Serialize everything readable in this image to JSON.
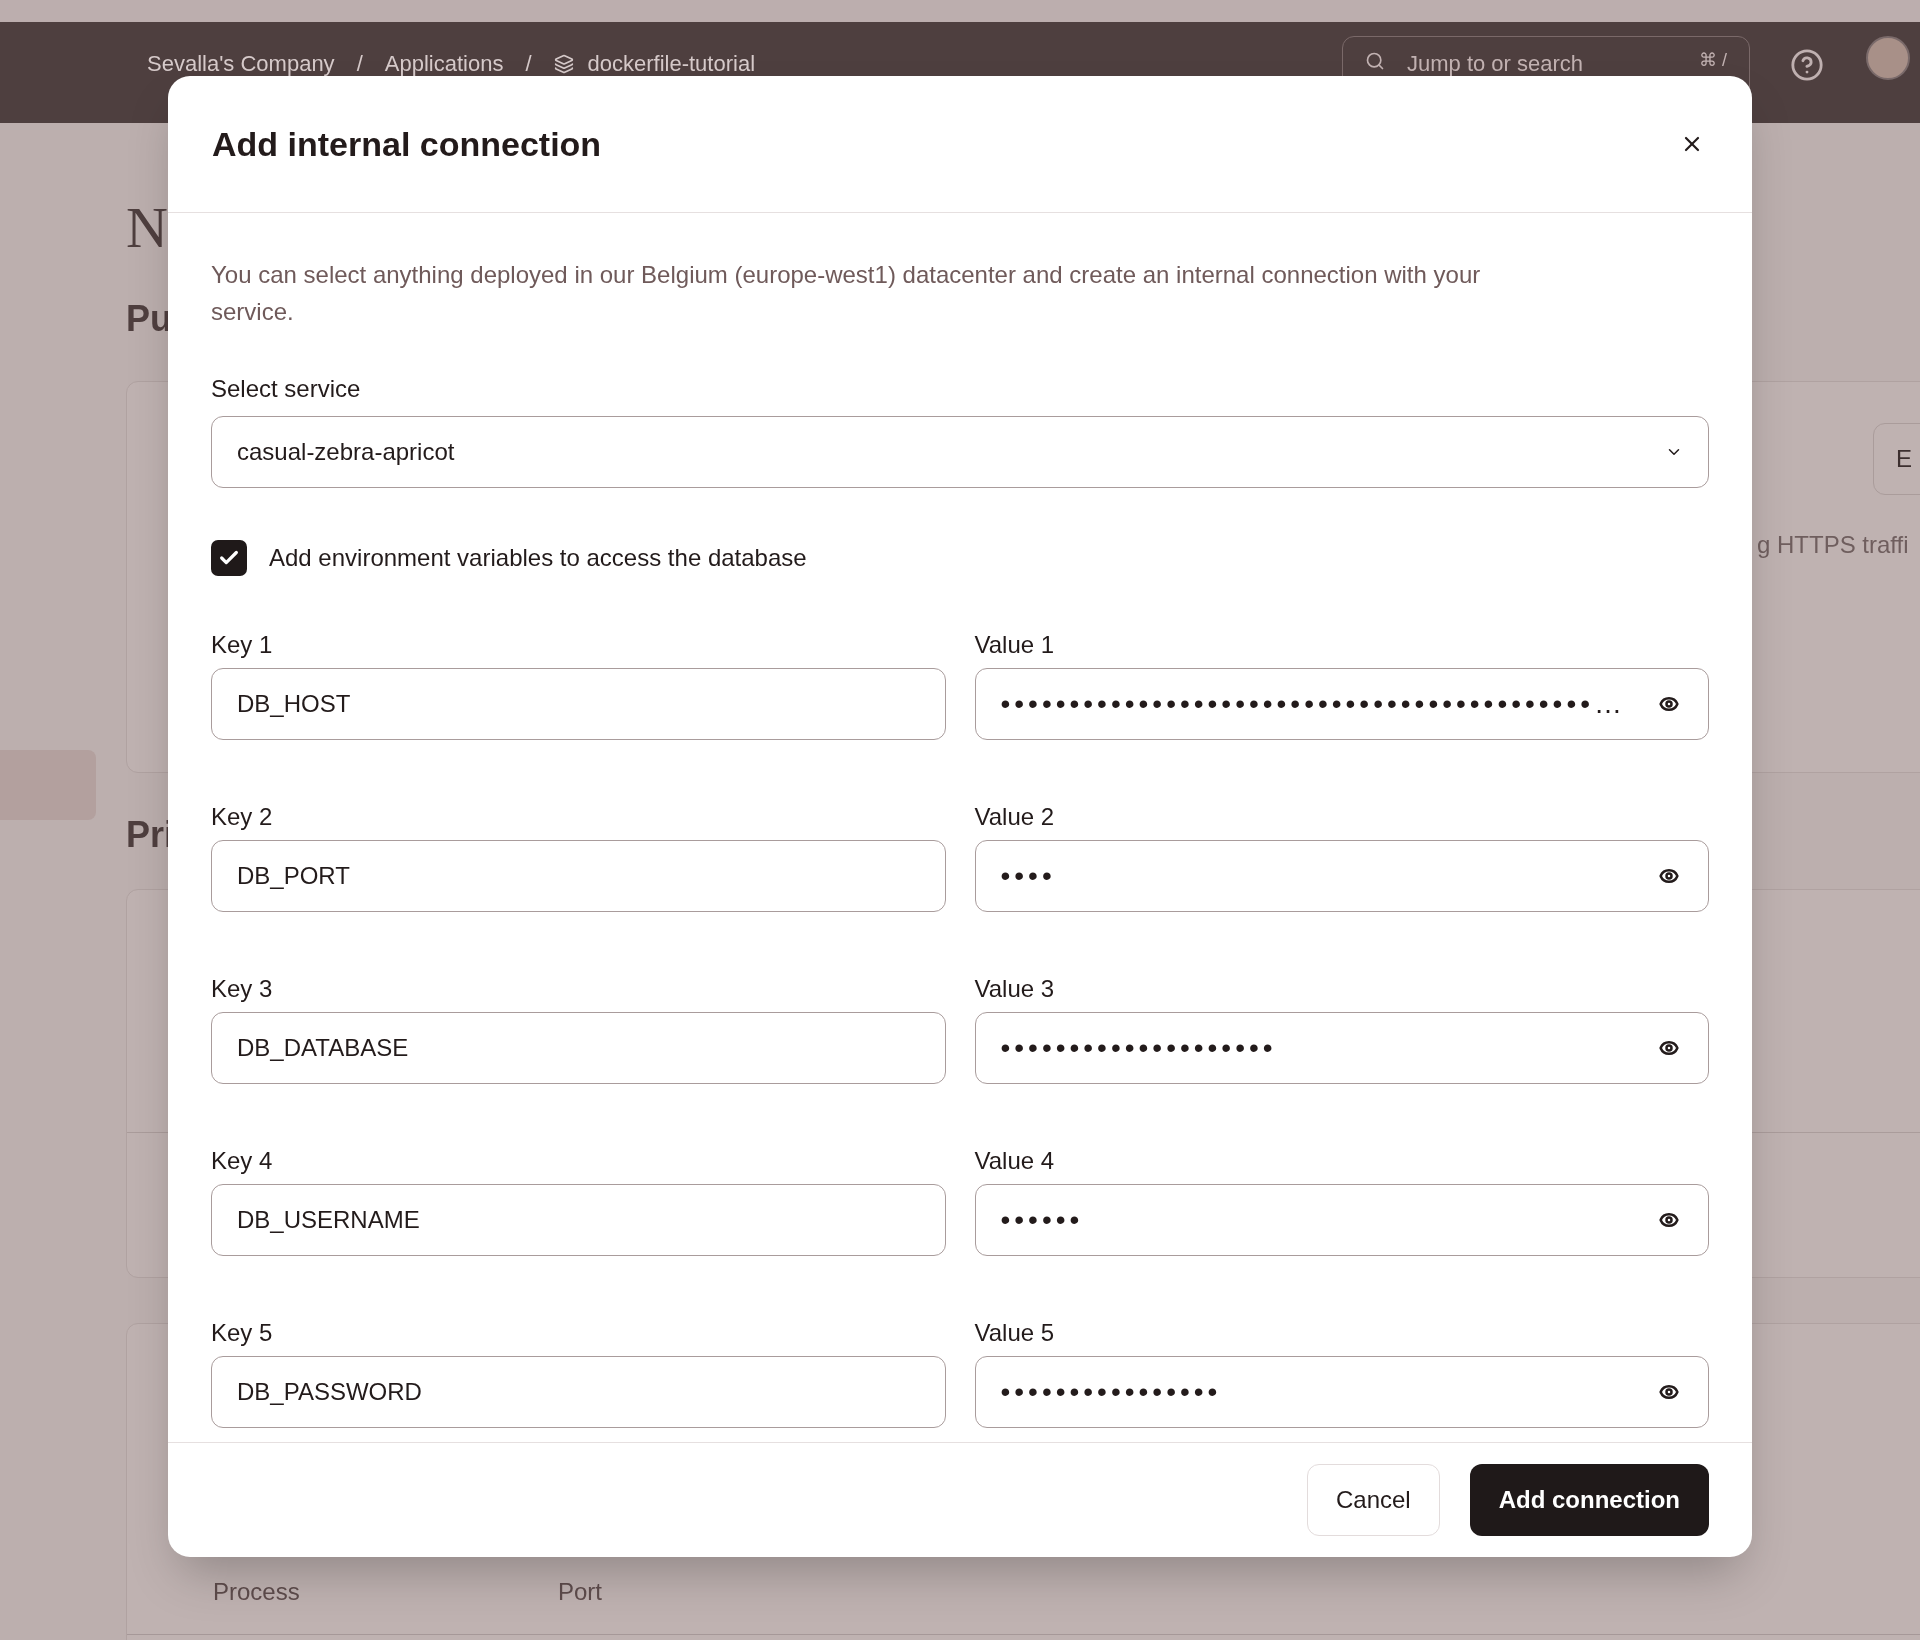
{
  "header": {
    "breadcrumbs": [
      {
        "label": "Sevalla's Company",
        "kind": "text"
      },
      {
        "separator": "/",
        "label": "Applications",
        "kind": "text"
      },
      {
        "separator": "/",
        "label": "dockerfile-tutorial",
        "kind": "app"
      }
    ],
    "search": {
      "placeholder": "Jump to or search",
      "shortcut": "⌘ /"
    }
  },
  "page": {
    "title": "N",
    "public_heading": "Pu",
    "public_card": {
      "button": "E",
      "text": "g HTTPS traffi"
    },
    "private_heading": "Pri",
    "table_columns": [
      "Process",
      "Port"
    ]
  },
  "modal": {
    "title": "Add internal connection",
    "description": "You can select anything deployed in our Belgium (europe-west1) datacenter and create an internal connection with your service.",
    "select": {
      "label": "Select service",
      "value": "casual-zebra-apricot"
    },
    "checkbox": {
      "label": "Add environment variables to access the database",
      "checked": true
    },
    "variables": [
      {
        "key_label": "Key 1",
        "key": "DB_HOST",
        "value_label": "Value 1",
        "value": "•••••••••••••••••••••••••••••••••••••••••••…"
      },
      {
        "key_label": "Key 2",
        "key": "DB_PORT",
        "value_label": "Value 2",
        "value": "••••"
      },
      {
        "key_label": "Key 3",
        "key": "DB_DATABASE",
        "value_label": "Value 3",
        "value": "••••••••••••••••••••"
      },
      {
        "key_label": "Key 4",
        "key": "DB_USERNAME",
        "value_label": "Value 4",
        "value": "••••••"
      },
      {
        "key_label": "Key 5",
        "key": "DB_PASSWORD",
        "value_label": "Value 5",
        "value": "••••••••••••••••"
      }
    ],
    "buttons": [
      {
        "label": "Cancel",
        "kind": "secondary"
      },
      {
        "label": "Add connection",
        "kind": "primary"
      }
    ]
  }
}
